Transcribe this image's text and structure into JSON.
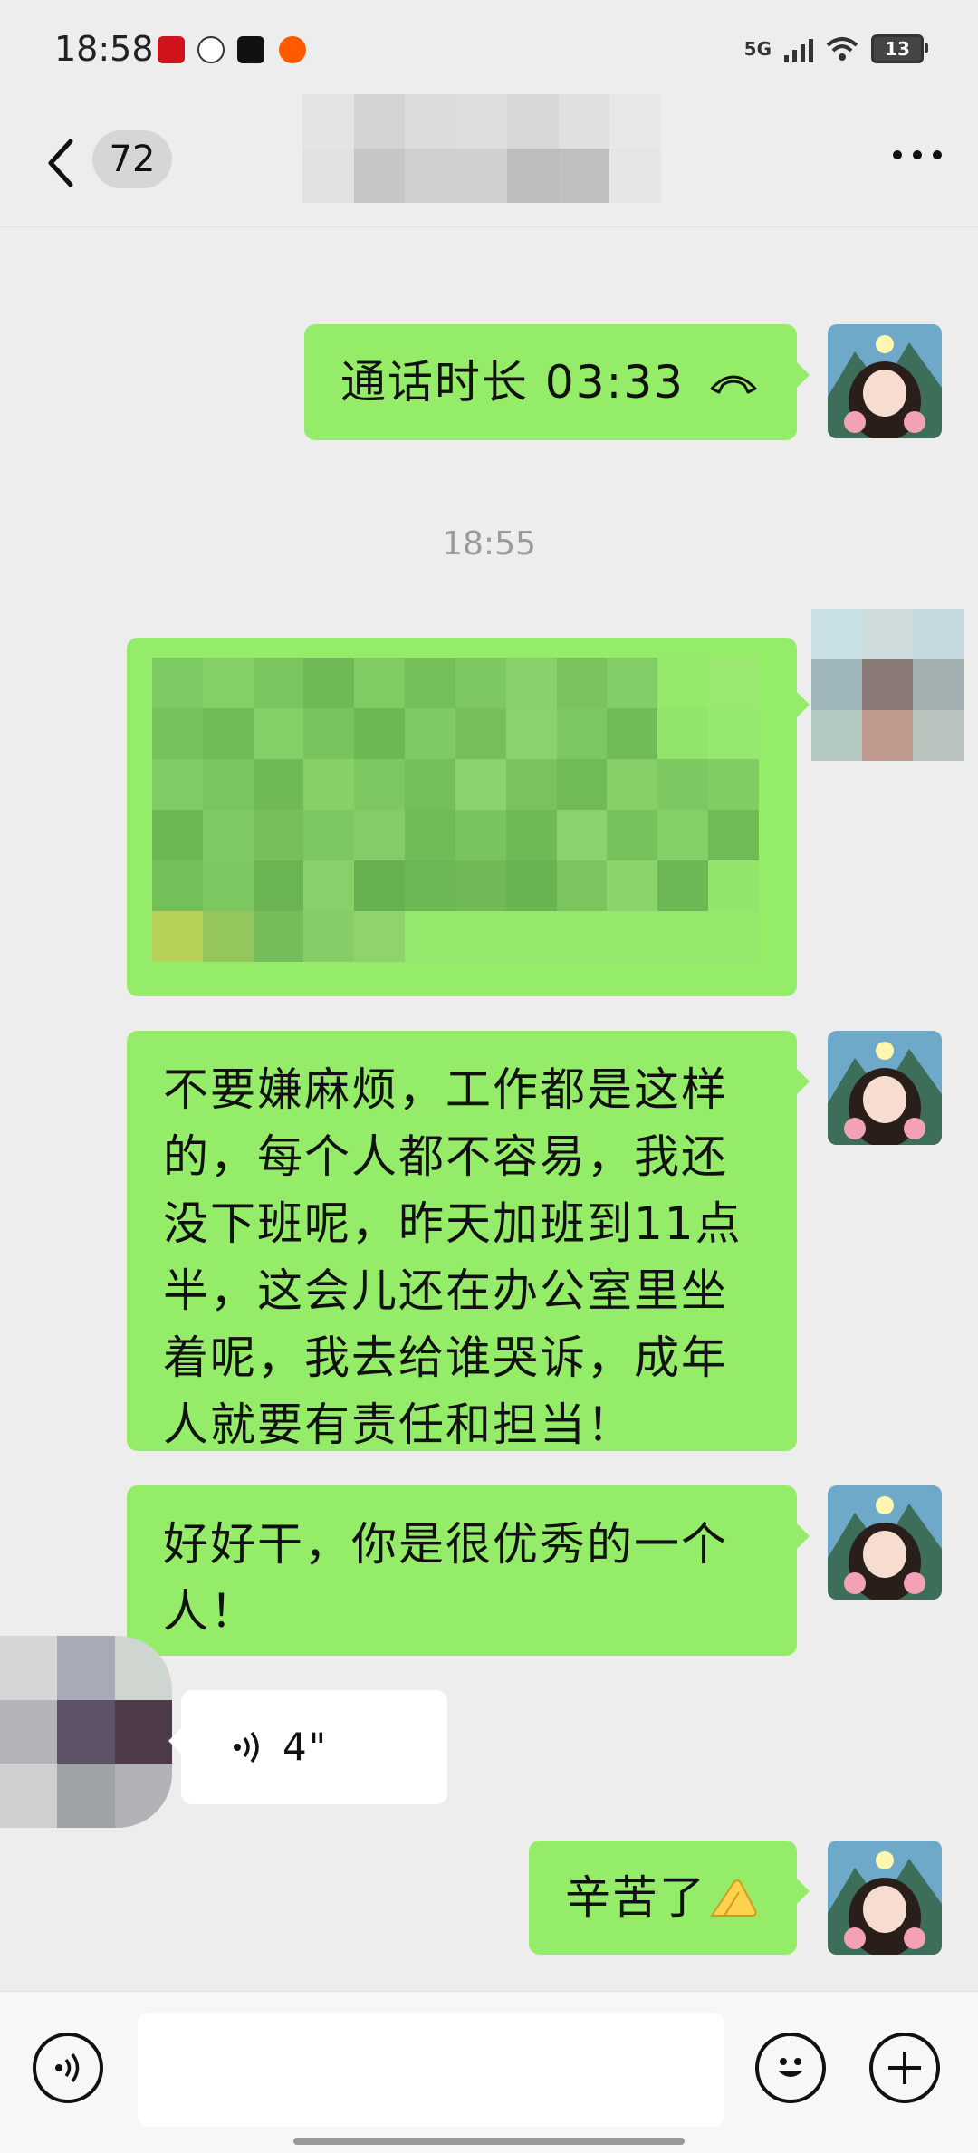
{
  "status_bar": {
    "time": "18:58",
    "network": "5G",
    "battery": "13",
    "icons": [
      "study-app-icon",
      "ring-app-icon",
      "soul-app-icon",
      "orange-app-icon",
      "signal-icon",
      "wifi-icon",
      "battery-icon"
    ]
  },
  "header": {
    "unread_count": "72",
    "title_obscured": true,
    "icons": [
      "back-icon",
      "more-icon"
    ]
  },
  "messages": {
    "call": {
      "text": "通话时长 03:33",
      "icon": "hangup-phone-icon"
    },
    "timestamp": "18:55",
    "text2": "不要嫌麻烦，工作都是这样的，每个人都不容易，我还没下班呢，昨天加班到11点半，这会儿还在办公室里坐着呢，我去给谁哭诉，成年人就要有责任和担当！",
    "text3": "好好干，你是很优秀的一个人！",
    "voice_duration": "4\"",
    "text4": "辛苦了",
    "text4_emoji": "folded-hands-emoji"
  },
  "input_bar": {
    "placeholder": "",
    "icons": [
      "voice-input-icon",
      "emoji-icon",
      "plus-icon"
    ]
  },
  "colors": {
    "bubble_self": "#95ec69",
    "bubble_other": "#ffffff",
    "background": "#ededed"
  }
}
